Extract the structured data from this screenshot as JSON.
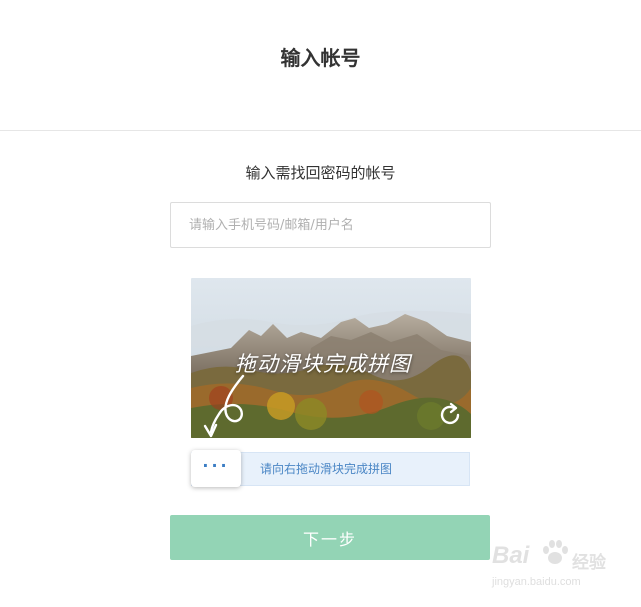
{
  "header": {
    "title": "输入帐号"
  },
  "form": {
    "subtitle": "输入需找回密码的帐号",
    "account_placeholder": "请输入手机号码/邮箱/用户名",
    "account_value": ""
  },
  "captcha": {
    "image_caption": "拖动滑块完成拼图",
    "refresh_icon": "refresh-icon",
    "hint_arrow_icon": "curved-arrow-down-icon",
    "slider_label": "请向右拖动滑块完成拼图",
    "slider_handle_glyph": "···",
    "slider_progress": 0
  },
  "actions": {
    "next_label": "下一步"
  },
  "watermark": {
    "brand": "Bai",
    "product": "经验",
    "url": "jingyan.baidu.com"
  },
  "colors": {
    "next_button": "#93d4b5",
    "slider_track": "#e8f1fb",
    "slider_text": "#4a86c5",
    "title_text": "#333333"
  }
}
